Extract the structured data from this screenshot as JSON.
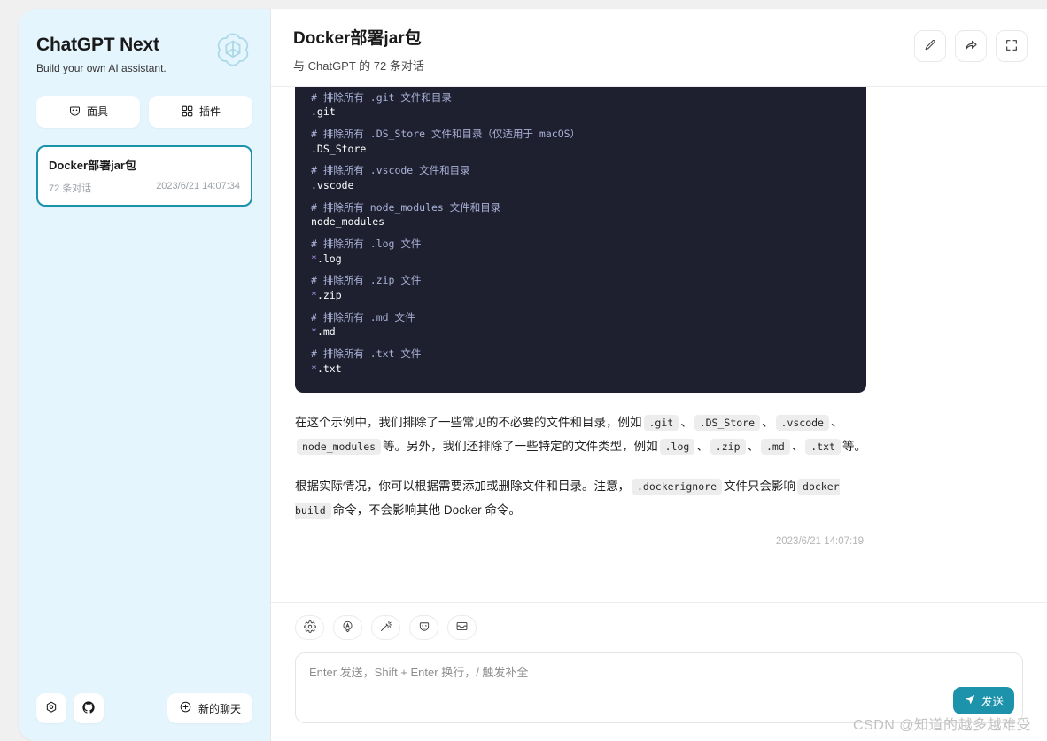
{
  "sidebar": {
    "brand_title": "ChatGPT Next",
    "brand_subtitle": "Build your own AI assistant.",
    "logo_icon": "openai-logo-icon",
    "actions": [
      {
        "label": "面具",
        "icon": "mask-icon"
      },
      {
        "label": "插件",
        "icon": "plugin-grid-icon"
      }
    ],
    "chats": [
      {
        "title": "Docker部署jar包",
        "count": "72 条对话",
        "time": "2023/6/21 14:07:34"
      }
    ],
    "footer": {
      "settings_icon": "settings-gear-icon",
      "github_icon": "github-icon",
      "new_chat_label": "新的聊天",
      "new_chat_icon": "plus-circle-icon"
    }
  },
  "header": {
    "title": "Docker部署jar包",
    "subtitle": "与 ChatGPT 的 72 条对话",
    "actions": [
      {
        "name": "rename-button",
        "icon": "pencil-icon"
      },
      {
        "name": "share-button",
        "icon": "share-arrow-icon"
      },
      {
        "name": "fullscreen-button",
        "icon": "maximize-icon"
      }
    ]
  },
  "message": {
    "code_lines": [
      {
        "comment": "# 排除所有 .git 文件和目录",
        "value": ".git",
        "star": false
      },
      {
        "comment": "# 排除所有 .DS_Store 文件和目录（仅适用于 macOS）",
        "value": ".DS_Store",
        "star": false
      },
      {
        "comment": "# 排除所有 .vscode 文件和目录",
        "value": ".vscode",
        "star": false
      },
      {
        "comment": "# 排除所有 node_modules 文件和目录",
        "value": "node_modules",
        "star": false
      },
      {
        "comment": "# 排除所有 .log 文件",
        "value": "*.log",
        "star": true
      },
      {
        "comment": "# 排除所有 .zip 文件",
        "value": "*.zip",
        "star": true
      },
      {
        "comment": "# 排除所有 .md 文件",
        "value": "*.md",
        "star": true
      },
      {
        "comment": "# 排除所有 .txt 文件",
        "value": "*.txt",
        "star": true
      }
    ],
    "paragraph_1": {
      "t1": "在这个示例中，我们排除了一些常见的不必要的文件和目录，例如",
      "c1": ".git",
      "s1": "、",
      "c2": ".DS_Store",
      "s2": "、",
      "c3": ".vscode",
      "s3": "、",
      "c4": "node_modules",
      "t2": "等。另外，我们还排除了一些特定的文件类型，例如",
      "c5": ".log",
      "s4": "、",
      "c6": ".zip",
      "s5": "、",
      "c7": ".md",
      "s6": "、",
      "c8": ".txt",
      "t3": "等。"
    },
    "paragraph_2": {
      "t1": "根据实际情况，你可以根据需要添加或删除文件和目录。注意，",
      "c1": ".dockerignore",
      "t2": "文件只会影响",
      "c2": "docker build",
      "t3": "命令，不会影响其他 Docker 命令。"
    },
    "timestamp": "2023/6/21 14:07:19"
  },
  "input": {
    "tools": [
      {
        "name": "settings-icon"
      },
      {
        "name": "theme-auto-icon"
      },
      {
        "name": "magic-wand-icon"
      },
      {
        "name": "mask-icon"
      },
      {
        "name": "clear-context-icon"
      }
    ],
    "placeholder": "Enter 发送，Shift + Enter 换行，/ 触发补全",
    "value": "",
    "send_label": "发送",
    "send_icon": "send-plane-icon",
    "send_color": "#1d93ab"
  },
  "watermark": "CSDN @知道的越多越难受",
  "colors": {
    "page_bg": "#f0f0f0",
    "sidebar_bg": "#e5f5fd",
    "accent": "#1d93ab",
    "code_bg": "#1e2030"
  }
}
